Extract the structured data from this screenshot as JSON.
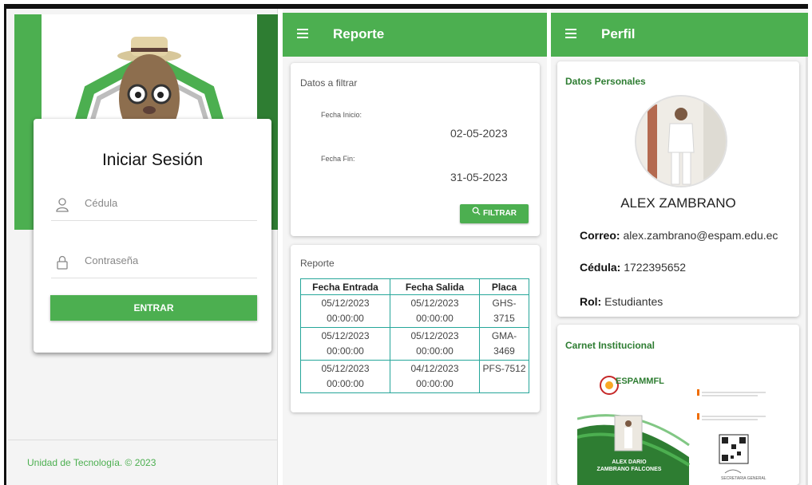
{
  "login": {
    "title": "Iniciar Sesión",
    "cedula_placeholder": "Cédula",
    "password_placeholder": "Contraseña",
    "enter_label": "ENTRAR",
    "footer": "Unidad de Tecnología. © 2023"
  },
  "reporte": {
    "appbar_title": "Reporte",
    "filter_heading": "Datos a filtrar",
    "fecha_inicio_label": "Fecha Inicio:",
    "fecha_inicio_value": "02-05-2023",
    "fecha_fin_label": "Fecha Fin:",
    "fecha_fin_value": "31-05-2023",
    "filter_button": "FILTRAR",
    "report_heading": "Reporte",
    "columns": [
      "Fecha Entrada",
      "Fecha Salida",
      "Placa"
    ],
    "rows": [
      {
        "entrada_date": "05/12/2023",
        "entrada_time": "00:00:00",
        "salida_date": "05/12/2023",
        "salida_time": "00:00:00",
        "placa_a": "GHS-",
        "placa_b": "3715"
      },
      {
        "entrada_date": "05/12/2023",
        "entrada_time": "00:00:00",
        "salida_date": "05/12/2023",
        "salida_time": "00:00:00",
        "placa_a": "GMA-",
        "placa_b": "3469"
      },
      {
        "entrada_date": "05/12/2023",
        "entrada_time": "00:00:00",
        "salida_date": "04/12/2023",
        "salida_time": "00:00:00",
        "placa_a": "PFS-7512",
        "placa_b": ""
      }
    ]
  },
  "perfil": {
    "appbar_title": "Perfil",
    "personal_heading": "Datos Personales",
    "name": "ALEX ZAMBRANO",
    "correo_label": "Correo:",
    "correo_value": "alex.zambrano@espam.edu.ec",
    "cedula_label": "Cédula:",
    "cedula_value": "1722395652",
    "rol_label": "Rol:",
    "rol_value": "Estudiantes",
    "carnet_heading": "Carnet Institucional",
    "carnet_brand": "ESPAMMFL",
    "carnet_name_line1": "ALEX DARIO",
    "carnet_name_line2": "ZAMBRANO FALCONES",
    "carnet_signature": "SECRETARIA GENERAL"
  },
  "colors": {
    "primary_green": "#4caf50",
    "dark_green": "#2e7d32",
    "table_border": "#26a69a"
  },
  "icons": [
    "menu-icon",
    "user-icon",
    "lock-icon",
    "search-icon"
  ]
}
